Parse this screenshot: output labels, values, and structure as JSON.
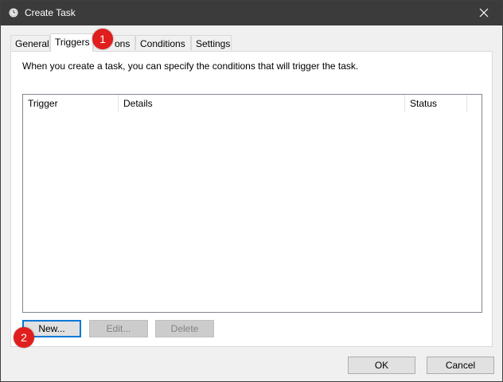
{
  "window": {
    "title": "Create Task"
  },
  "tabs": [
    {
      "label": "General",
      "active": false
    },
    {
      "label": "Triggers",
      "active": true
    },
    {
      "label": "Actions",
      "active": false,
      "visible_text": "ons"
    },
    {
      "label": "Conditions",
      "active": false
    },
    {
      "label": "Settings",
      "active": false
    }
  ],
  "triggers_panel": {
    "description": "When you create a task, you can specify the conditions that will trigger the task.",
    "columns": [
      "Trigger",
      "Details",
      "Status"
    ],
    "rows": [],
    "buttons": {
      "new": "New...",
      "edit": "Edit...",
      "delete": "Delete"
    }
  },
  "footer": {
    "ok": "OK",
    "cancel": "Cancel"
  },
  "annotations": [
    {
      "number": "1"
    },
    {
      "number": "2"
    }
  ],
  "colors": {
    "titlebar": "#3b3b3b",
    "badge": "#e01e1e",
    "default_button_border": "#0078d7"
  },
  "icons": {
    "title": "task-scheduler-clock-icon",
    "close": "close-icon"
  }
}
